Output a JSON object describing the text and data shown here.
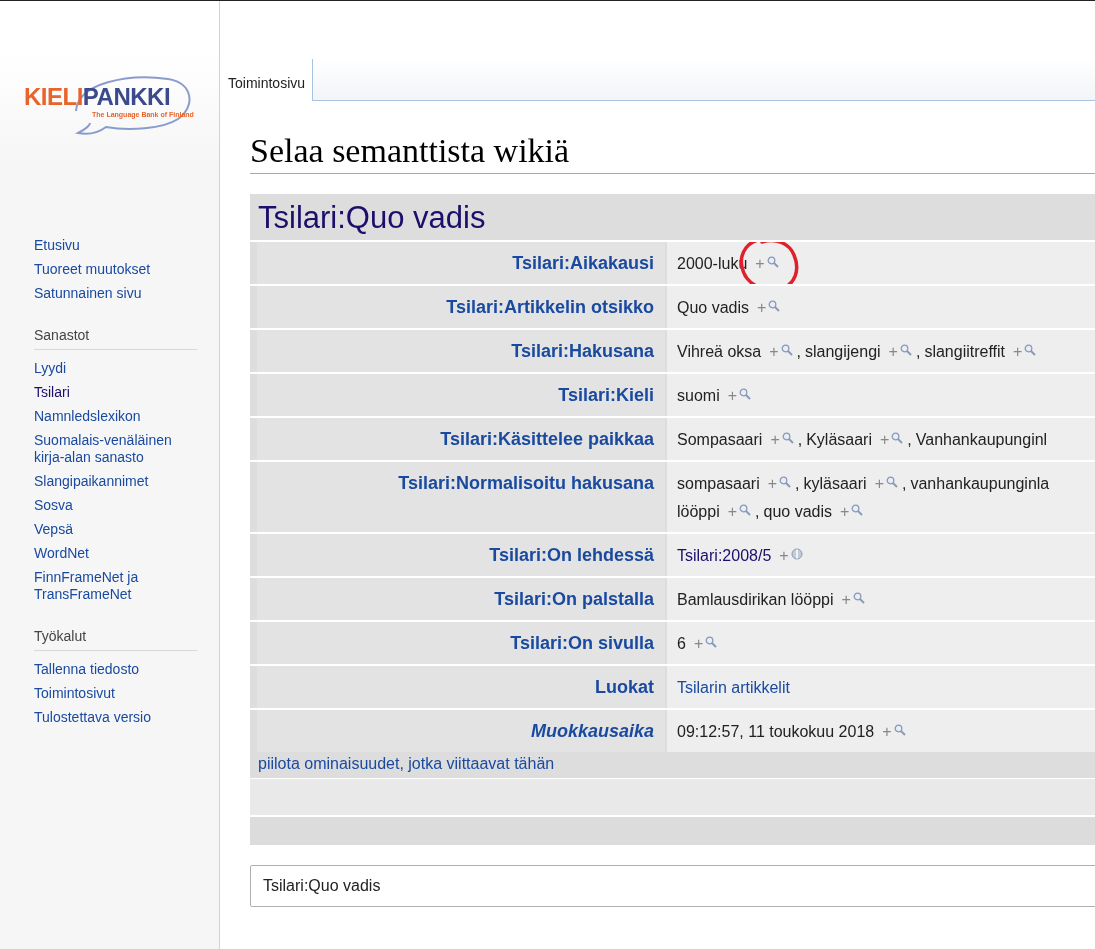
{
  "logo": {
    "part1": "KIELI",
    "part2": "PANKKI",
    "tagline": "The Language Bank of Finland"
  },
  "nav": [
    {
      "items": [
        {
          "label": "Etusivu",
          "visited": false
        },
        {
          "label": "Tuoreet muutokset",
          "visited": false
        },
        {
          "label": "Satunnainen sivu",
          "visited": false
        }
      ]
    },
    {
      "heading": "Sanastot",
      "items": [
        {
          "label": "Lyydi",
          "visited": false
        },
        {
          "label": "Tsilari",
          "visited": true
        },
        {
          "label": "Namnledslexikon",
          "visited": false
        },
        {
          "label": "Suomalais-venäläinen kirja-alan sanasto",
          "visited": false
        },
        {
          "label": "Slangipaikannimet",
          "visited": false
        },
        {
          "label": "Sosva",
          "visited": false
        },
        {
          "label": "Vepsä",
          "visited": false
        },
        {
          "label": "WordNet",
          "visited": false
        },
        {
          "label": "FinnFrameNet ja TransFrameNet",
          "visited": false
        }
      ]
    },
    {
      "heading": "Työkalut",
      "items": [
        {
          "label": "Tallenna tiedosto",
          "visited": false
        },
        {
          "label": "Toimintosivut",
          "visited": false
        },
        {
          "label": "Tulostettava versio",
          "visited": false
        }
      ]
    }
  ],
  "tabs": [
    {
      "label": "Toimintosivu",
      "selected": true
    }
  ],
  "page_title": "Selaa semanttista wikiä",
  "subject": "Tsilari:Quo vadis",
  "properties": [
    {
      "label": "Tsilari:Aikakausi",
      "kind": "normal",
      "lines": [
        [
          {
            "text": "2000-luku",
            "kind": "text",
            "action": {
              "plus": "+",
              "kind": "search"
            },
            "circled": true
          }
        ]
      ]
    },
    {
      "label": "Tsilari:Artikkelin otsikko",
      "kind": "normal",
      "lines": [
        [
          {
            "text": "Quo vadis",
            "kind": "text",
            "action": {
              "plus": "+",
              "kind": "search"
            },
            "circled": false
          }
        ]
      ]
    },
    {
      "label": "Tsilari:Hakusana",
      "kind": "normal",
      "lines": [
        [
          {
            "text": "Vihreä oksa",
            "kind": "text",
            "action": {
              "plus": "+",
              "kind": "search"
            },
            "circled": false
          },
          {
            "sep": ",",
            "text": "slangijengi",
            "kind": "text",
            "action": {
              "plus": "+",
              "kind": "search"
            },
            "circled": false
          },
          {
            "sep": ",",
            "text": "slangiitreffit",
            "kind": "text",
            "action": {
              "plus": "+",
              "kind": "search"
            },
            "circled": false
          }
        ]
      ]
    },
    {
      "label": "Tsilari:Kieli",
      "kind": "normal",
      "lines": [
        [
          {
            "text": "suomi",
            "kind": "text",
            "action": {
              "plus": "+",
              "kind": "search"
            },
            "circled": false
          }
        ]
      ]
    },
    {
      "label": "Tsilari:Käsittelee paikkaa",
      "kind": "normal",
      "lines": [
        [
          {
            "text": "Sompasaari",
            "kind": "text",
            "action": {
              "plus": "+",
              "kind": "search"
            },
            "circled": false
          },
          {
            "sep": ",",
            "text": "Kyläsaari",
            "kind": "text",
            "action": {
              "plus": "+",
              "kind": "search"
            },
            "circled": false
          },
          {
            "sep": ",",
            "text": "Vanhankaupunginl",
            "kind": "text",
            "circled": false
          }
        ]
      ]
    },
    {
      "label": "Tsilari:Normalisoitu hakusana",
      "kind": "normal",
      "lines": [
        [
          {
            "text": "sompasaari",
            "kind": "text",
            "action": {
              "plus": "+",
              "kind": "search"
            },
            "circled": false
          },
          {
            "sep": ",",
            "text": "kyläsaari",
            "kind": "text",
            "action": {
              "plus": "+",
              "kind": "search"
            },
            "circled": false
          },
          {
            "sep": ",",
            "text": "vanhankaupunginla",
            "kind": "text",
            "circled": false
          }
        ],
        [
          {
            "text": "lööppi",
            "kind": "text",
            "action": {
              "plus": "+",
              "kind": "search"
            },
            "circled": false
          },
          {
            "sep": ",",
            "text": "quo vadis",
            "kind": "text",
            "action": {
              "plus": "+",
              "kind": "search"
            },
            "circled": false
          }
        ]
      ]
    },
    {
      "label": "Tsilari:On lehdessä",
      "kind": "normal",
      "lines": [
        [
          {
            "text": "Tsilari:2008/5",
            "kind": "visited-link",
            "action": {
              "plus": "+",
              "kind": "browse"
            },
            "circled": false
          }
        ]
      ]
    },
    {
      "label": "Tsilari:On palstalla",
      "kind": "normal",
      "lines": [
        [
          {
            "text": "Bamlausdirikan lööppi",
            "kind": "text",
            "action": {
              "plus": "+",
              "kind": "search"
            },
            "circled": false
          }
        ]
      ]
    },
    {
      "label": "Tsilari:On sivulla",
      "kind": "normal",
      "lines": [
        [
          {
            "text": "6",
            "kind": "text",
            "action": {
              "plus": "+",
              "kind": "search"
            },
            "circled": false
          }
        ]
      ]
    },
    {
      "label": "Luokat",
      "kind": "normal",
      "lines": [
        [
          {
            "text": "Tsilarin artikkelit",
            "kind": "link",
            "circled": false
          }
        ]
      ]
    },
    {
      "label": "Muokkausaika",
      "kind": "special",
      "lines": [
        [
          {
            "text": "09:12:57, 11 toukokuu 2018",
            "kind": "text",
            "action": {
              "plus": "+",
              "kind": "search"
            },
            "circled": false
          }
        ]
      ]
    }
  ],
  "hide_link": "piilota ominaisuudet, jotka viittaavat tähän",
  "search_field": {
    "value": "Tsilari:Quo vadis"
  }
}
